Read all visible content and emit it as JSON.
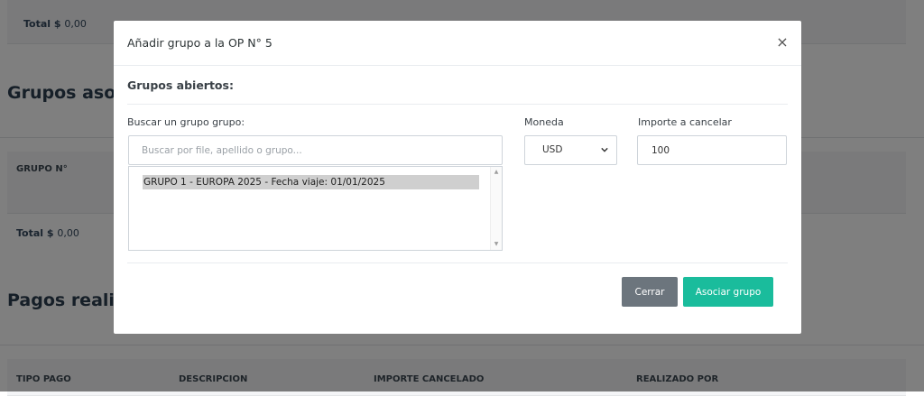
{
  "background": {
    "totals": [
      {
        "label": "Total $",
        "value": "0,00"
      },
      {
        "label": "Total $",
        "value": "0,00"
      }
    ],
    "headings": {
      "grupos": "Grupos asociados",
      "pagos": "Pagos realizados"
    },
    "grupos_table_header": "GRUPO N°",
    "pagos_table_headers": [
      "TIPO PAGO",
      "DESCRIPCION",
      "IMPORTE CANCELADO",
      "REALIZADO POR"
    ]
  },
  "modal": {
    "title": "Añadir grupo a la OP N° 5",
    "close_symbol": "×",
    "section_title": "Grupos abiertos:",
    "search": {
      "label": "Buscar un grupo grupo:",
      "placeholder": "Buscar por file, apellido o grupo...",
      "value": ""
    },
    "results": [
      "GRUPO 1 - EUROPA 2025 - Fecha viaje: 01/01/2025"
    ],
    "currency": {
      "label": "Moneda",
      "selected": "USD"
    },
    "amount": {
      "label": "Importe a cancelar",
      "value": "100"
    },
    "buttons": {
      "close": "Cerrar",
      "associate": "Asociar grupo"
    }
  },
  "colors": {
    "overlay": "#000000",
    "primary_button": "#1abc9c",
    "secondary_button": "#6c757d",
    "selected_option": "#cfcfcf"
  }
}
